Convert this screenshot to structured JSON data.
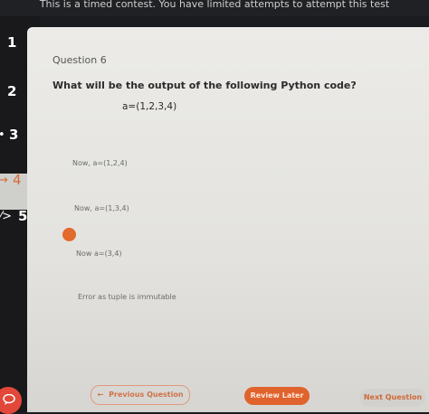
{
  "banner": {
    "text": "This is a timed contest. You have limited attempts to attempt this test"
  },
  "sidebar": {
    "items": [
      {
        "number": "1"
      },
      {
        "number": "2"
      },
      {
        "number": "3"
      },
      {
        "number": "4"
      },
      {
        "number": "5"
      }
    ]
  },
  "question": {
    "number_label": "Question 6",
    "text": "What will be the output of the following Python code?",
    "code": "a=(1,2,3,4)",
    "options": [
      "Now, a=(1,2,4)",
      "Now, a=(1,3,4)",
      "Now a=(3,4)",
      "Error as tuple is immutable"
    ]
  },
  "footer": {
    "previous_label": "Previous Question",
    "review_label": "Review Later",
    "next_label": "Next Question"
  },
  "colors": {
    "accent": "#e0622c",
    "sidebar_bg": "#19191b",
    "panel_bg": "#ecebe8"
  }
}
